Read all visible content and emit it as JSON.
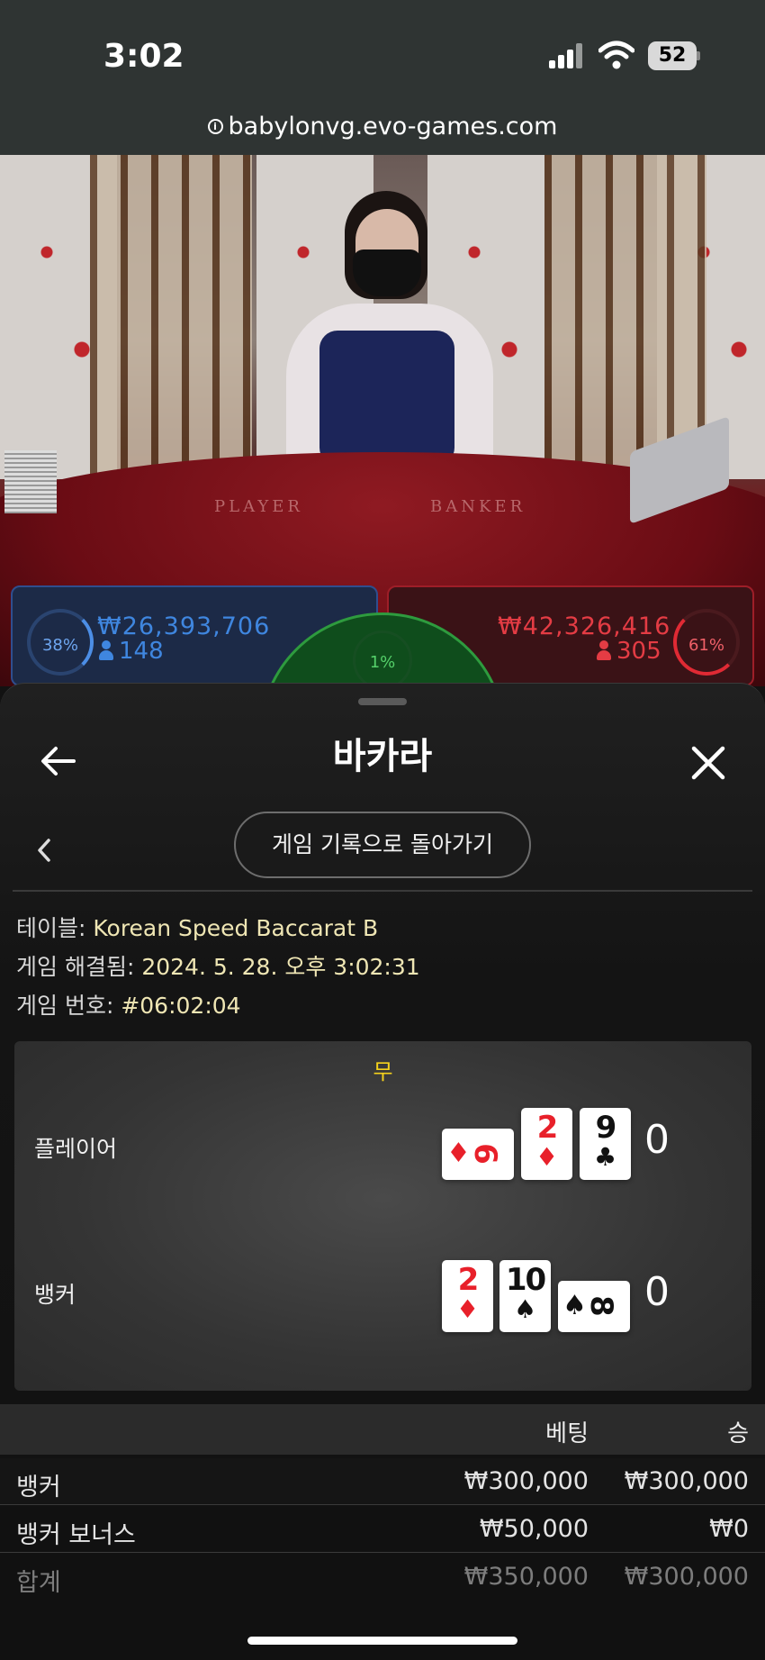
{
  "status_bar": {
    "time": "3:02",
    "battery": "52"
  },
  "browser": {
    "url": "babylonvg.evo-games.com"
  },
  "stream": {
    "table_text_player": "PLAYER",
    "table_text_banker": "BANKER",
    "player_side": {
      "percent": "38%",
      "amount": "₩26,393,706",
      "players": "148"
    },
    "tie_side": {
      "percent": "1%"
    },
    "banker_side": {
      "percent": "61%",
      "amount": "₩42,326,416",
      "players": "305"
    }
  },
  "sheet": {
    "title": "바카라",
    "back_to_history": "게임 기록으로 돌아가기",
    "info": {
      "table_label": "테이블: ",
      "table_value": "Korean Speed Baccarat B",
      "resolved_label": "게임 해결됨: ",
      "resolved_value": "2024. 5. 28. 오후 3:02:31",
      "number_label": "게임 번호: ",
      "number_value": "#06:02:04"
    },
    "result": {
      "outcome": "무",
      "player": {
        "label": "플레이어",
        "cards": [
          {
            "rank": "6",
            "suit": "♦",
            "color": "#e8202a",
            "sideways": true
          },
          {
            "rank": "2",
            "suit": "♦",
            "color": "#e8202a",
            "sideways": false
          },
          {
            "rank": "9",
            "suit": "♣",
            "color": "#111111",
            "sideways": false
          }
        ],
        "score": "0"
      },
      "banker": {
        "label": "뱅커",
        "cards": [
          {
            "rank": "2",
            "suit": "♦",
            "color": "#e8202a",
            "sideways": false
          },
          {
            "rank": "10",
            "suit": "♠",
            "color": "#111111",
            "sideways": false
          },
          {
            "rank": "8",
            "suit": "♠",
            "color": "#111111",
            "sideways": true
          }
        ],
        "score": "0"
      }
    },
    "bets": {
      "col_bet": "베팅",
      "col_win": "승",
      "rows": [
        {
          "label": "뱅커",
          "bet": "₩300,000",
          "win": "₩300,000"
        },
        {
          "label": "뱅커 보너스",
          "bet": "₩50,000",
          "win": "₩0"
        }
      ],
      "total": {
        "label": "합계",
        "bet": "₩350,000",
        "win": "₩300,000"
      }
    }
  }
}
